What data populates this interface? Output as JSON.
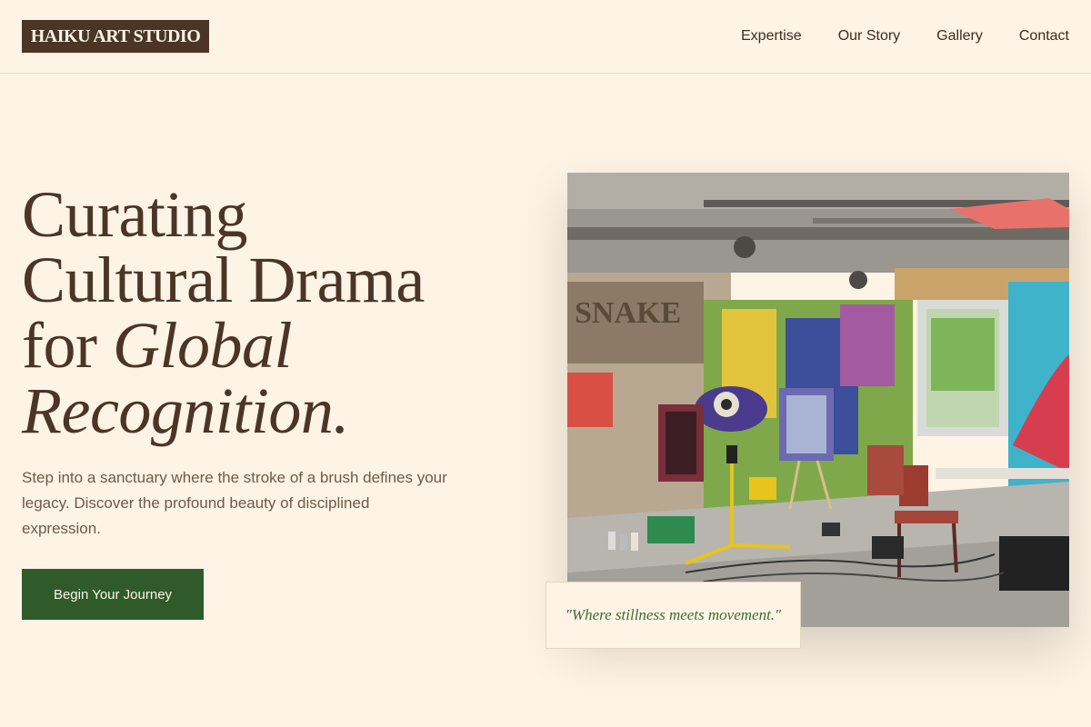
{
  "header": {
    "logo": "HAIKU ART STUDIO",
    "nav": [
      "Expertise",
      "Our Story",
      "Gallery",
      "Contact"
    ]
  },
  "hero": {
    "title_line1": "Curating",
    "title_line2": "Cultural Drama",
    "title_line3_plain": "for ",
    "title_line3_italic": "Global",
    "title_line4_italic": "Recognition.",
    "description": "Step into a sanctuary where the stroke of a brush defines your legacy. Discover the profound beauty of disciplined expression.",
    "cta_label": "Begin Your Journey"
  },
  "image": {
    "graffiti_word": "SNAKE",
    "alt": "Graffiti-covered art studio with easels and chairs"
  },
  "quote": "\"Where stillness meets movement.\"",
  "colors": {
    "background": "#fdf4e6",
    "brown": "#4a3526",
    "green": "#2f5b2b",
    "quote_green": "#3f6b37"
  }
}
